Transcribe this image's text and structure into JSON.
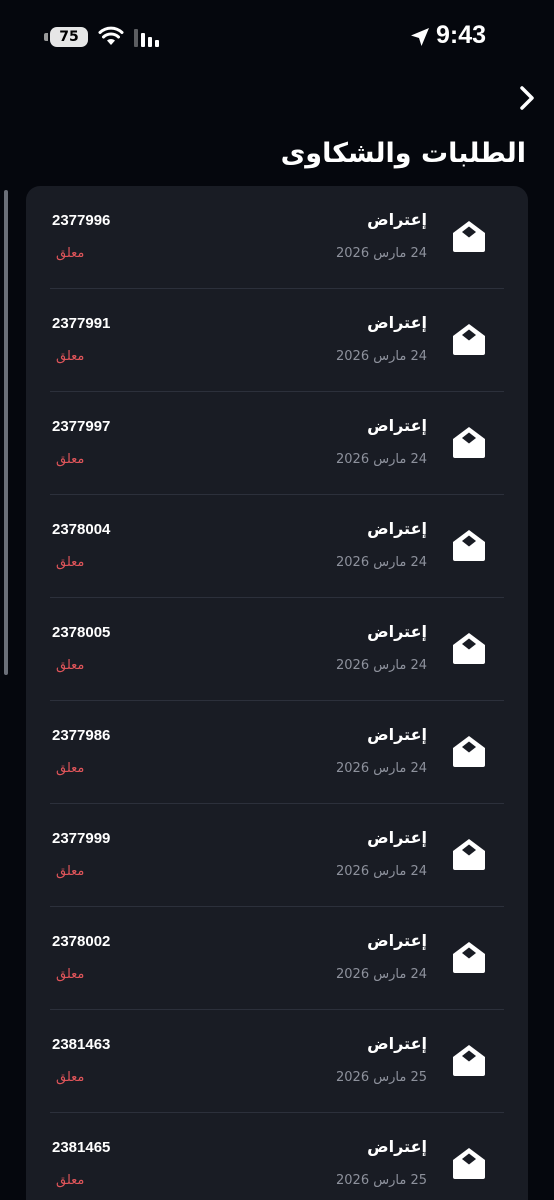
{
  "status_bar": {
    "time": "9:43",
    "battery": "75",
    "icons": [
      "battery-icon",
      "wifi-icon",
      "signal-icon",
      "location-arrow-icon"
    ]
  },
  "header": {
    "title": "الطلبات والشكاوى",
    "back_icon": "chevron-right-icon"
  },
  "colors": {
    "background": "#05070d",
    "card": "#191c24",
    "status_pending": "#e0555a",
    "secondary_text": "#8d919c"
  },
  "requests": [
    {
      "type": "إعتراض",
      "date": "24 مارس 2026",
      "id": "2377996",
      "status": "معلق"
    },
    {
      "type": "إعتراض",
      "date": "24 مارس 2026",
      "id": "2377991",
      "status": "معلق"
    },
    {
      "type": "إعتراض",
      "date": "24 مارس 2026",
      "id": "2377997",
      "status": "معلق"
    },
    {
      "type": "إعتراض",
      "date": "24 مارس 2026",
      "id": "2378004",
      "status": "معلق"
    },
    {
      "type": "إعتراض",
      "date": "24 مارس 2026",
      "id": "2378005",
      "status": "معلق"
    },
    {
      "type": "إعتراض",
      "date": "24 مارس 2026",
      "id": "2377986",
      "status": "معلق"
    },
    {
      "type": "إعتراض",
      "date": "24 مارس 2026",
      "id": "2377999",
      "status": "معلق"
    },
    {
      "type": "إعتراض",
      "date": "24 مارس 2026",
      "id": "2378002",
      "status": "معلق"
    },
    {
      "type": "إعتراض",
      "date": "25 مارس 2026",
      "id": "2381463",
      "status": "معلق"
    },
    {
      "type": "إعتراض",
      "date": "25 مارس 2026",
      "id": "2381465",
      "status": "معلق"
    }
  ]
}
